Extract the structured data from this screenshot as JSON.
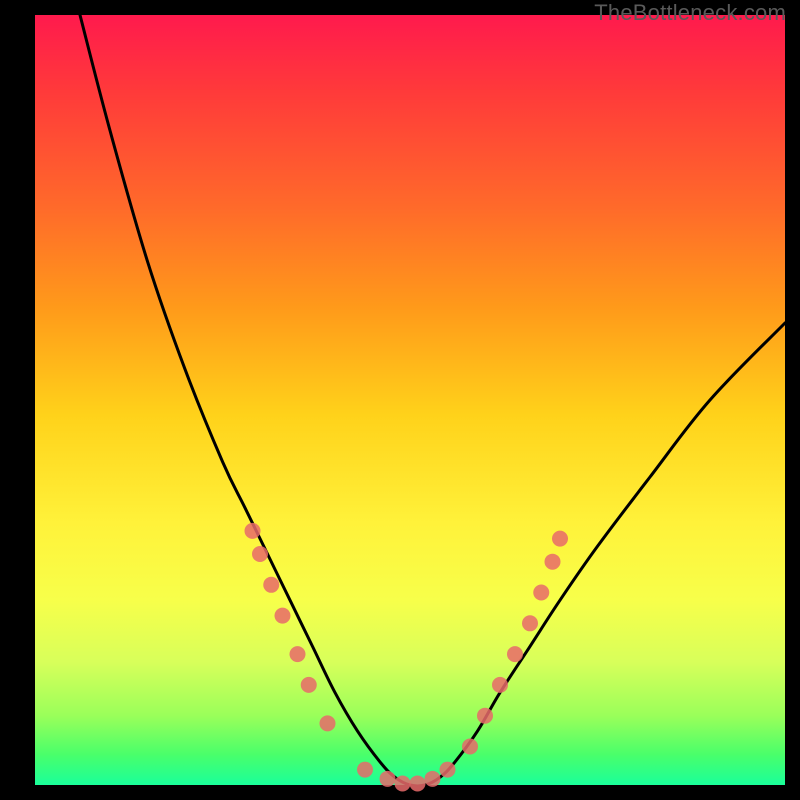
{
  "watermark": "TheBottleneck.com",
  "chart_data": {
    "type": "line",
    "title": "",
    "xlabel": "",
    "ylabel": "",
    "xlim": [
      0,
      100
    ],
    "ylim": [
      0,
      100
    ],
    "series": [
      {
        "name": "bottleneck-curve",
        "x": [
          6,
          10,
          15,
          20,
          25,
          28,
          31,
          34,
          37,
          40,
          43,
          46,
          48,
          50,
          52,
          54,
          56,
          59,
          62,
          66,
          70,
          75,
          82,
          90,
          100
        ],
        "values": [
          100,
          85,
          68,
          54,
          42,
          36,
          30,
          24,
          18,
          12,
          7,
          3,
          1,
          0,
          0,
          1,
          3,
          7,
          12,
          18,
          24,
          31,
          40,
          50,
          60
        ]
      }
    ],
    "markers": {
      "name": "highlighted-points",
      "color": "#e86a6a",
      "points": [
        {
          "x": 29,
          "y": 33
        },
        {
          "x": 30,
          "y": 30
        },
        {
          "x": 31.5,
          "y": 26
        },
        {
          "x": 33,
          "y": 22
        },
        {
          "x": 35,
          "y": 17
        },
        {
          "x": 36.5,
          "y": 13
        },
        {
          "x": 39,
          "y": 8
        },
        {
          "x": 44,
          "y": 2
        },
        {
          "x": 47,
          "y": 0.8
        },
        {
          "x": 49,
          "y": 0.2
        },
        {
          "x": 51,
          "y": 0.2
        },
        {
          "x": 53,
          "y": 0.8
        },
        {
          "x": 55,
          "y": 2
        },
        {
          "x": 58,
          "y": 5
        },
        {
          "x": 60,
          "y": 9
        },
        {
          "x": 62,
          "y": 13
        },
        {
          "x": 64,
          "y": 17
        },
        {
          "x": 66,
          "y": 21
        },
        {
          "x": 67.5,
          "y": 25
        },
        {
          "x": 69,
          "y": 29
        },
        {
          "x": 70,
          "y": 32
        }
      ]
    },
    "gradient_stops": [
      {
        "pos": 0,
        "color": "#ff1a4d"
      },
      {
        "pos": 25,
        "color": "#ff6a2a"
      },
      {
        "pos": 52,
        "color": "#ffd21a"
      },
      {
        "pos": 76,
        "color": "#f7ff4a"
      },
      {
        "pos": 100,
        "color": "#1aff9a"
      }
    ]
  }
}
